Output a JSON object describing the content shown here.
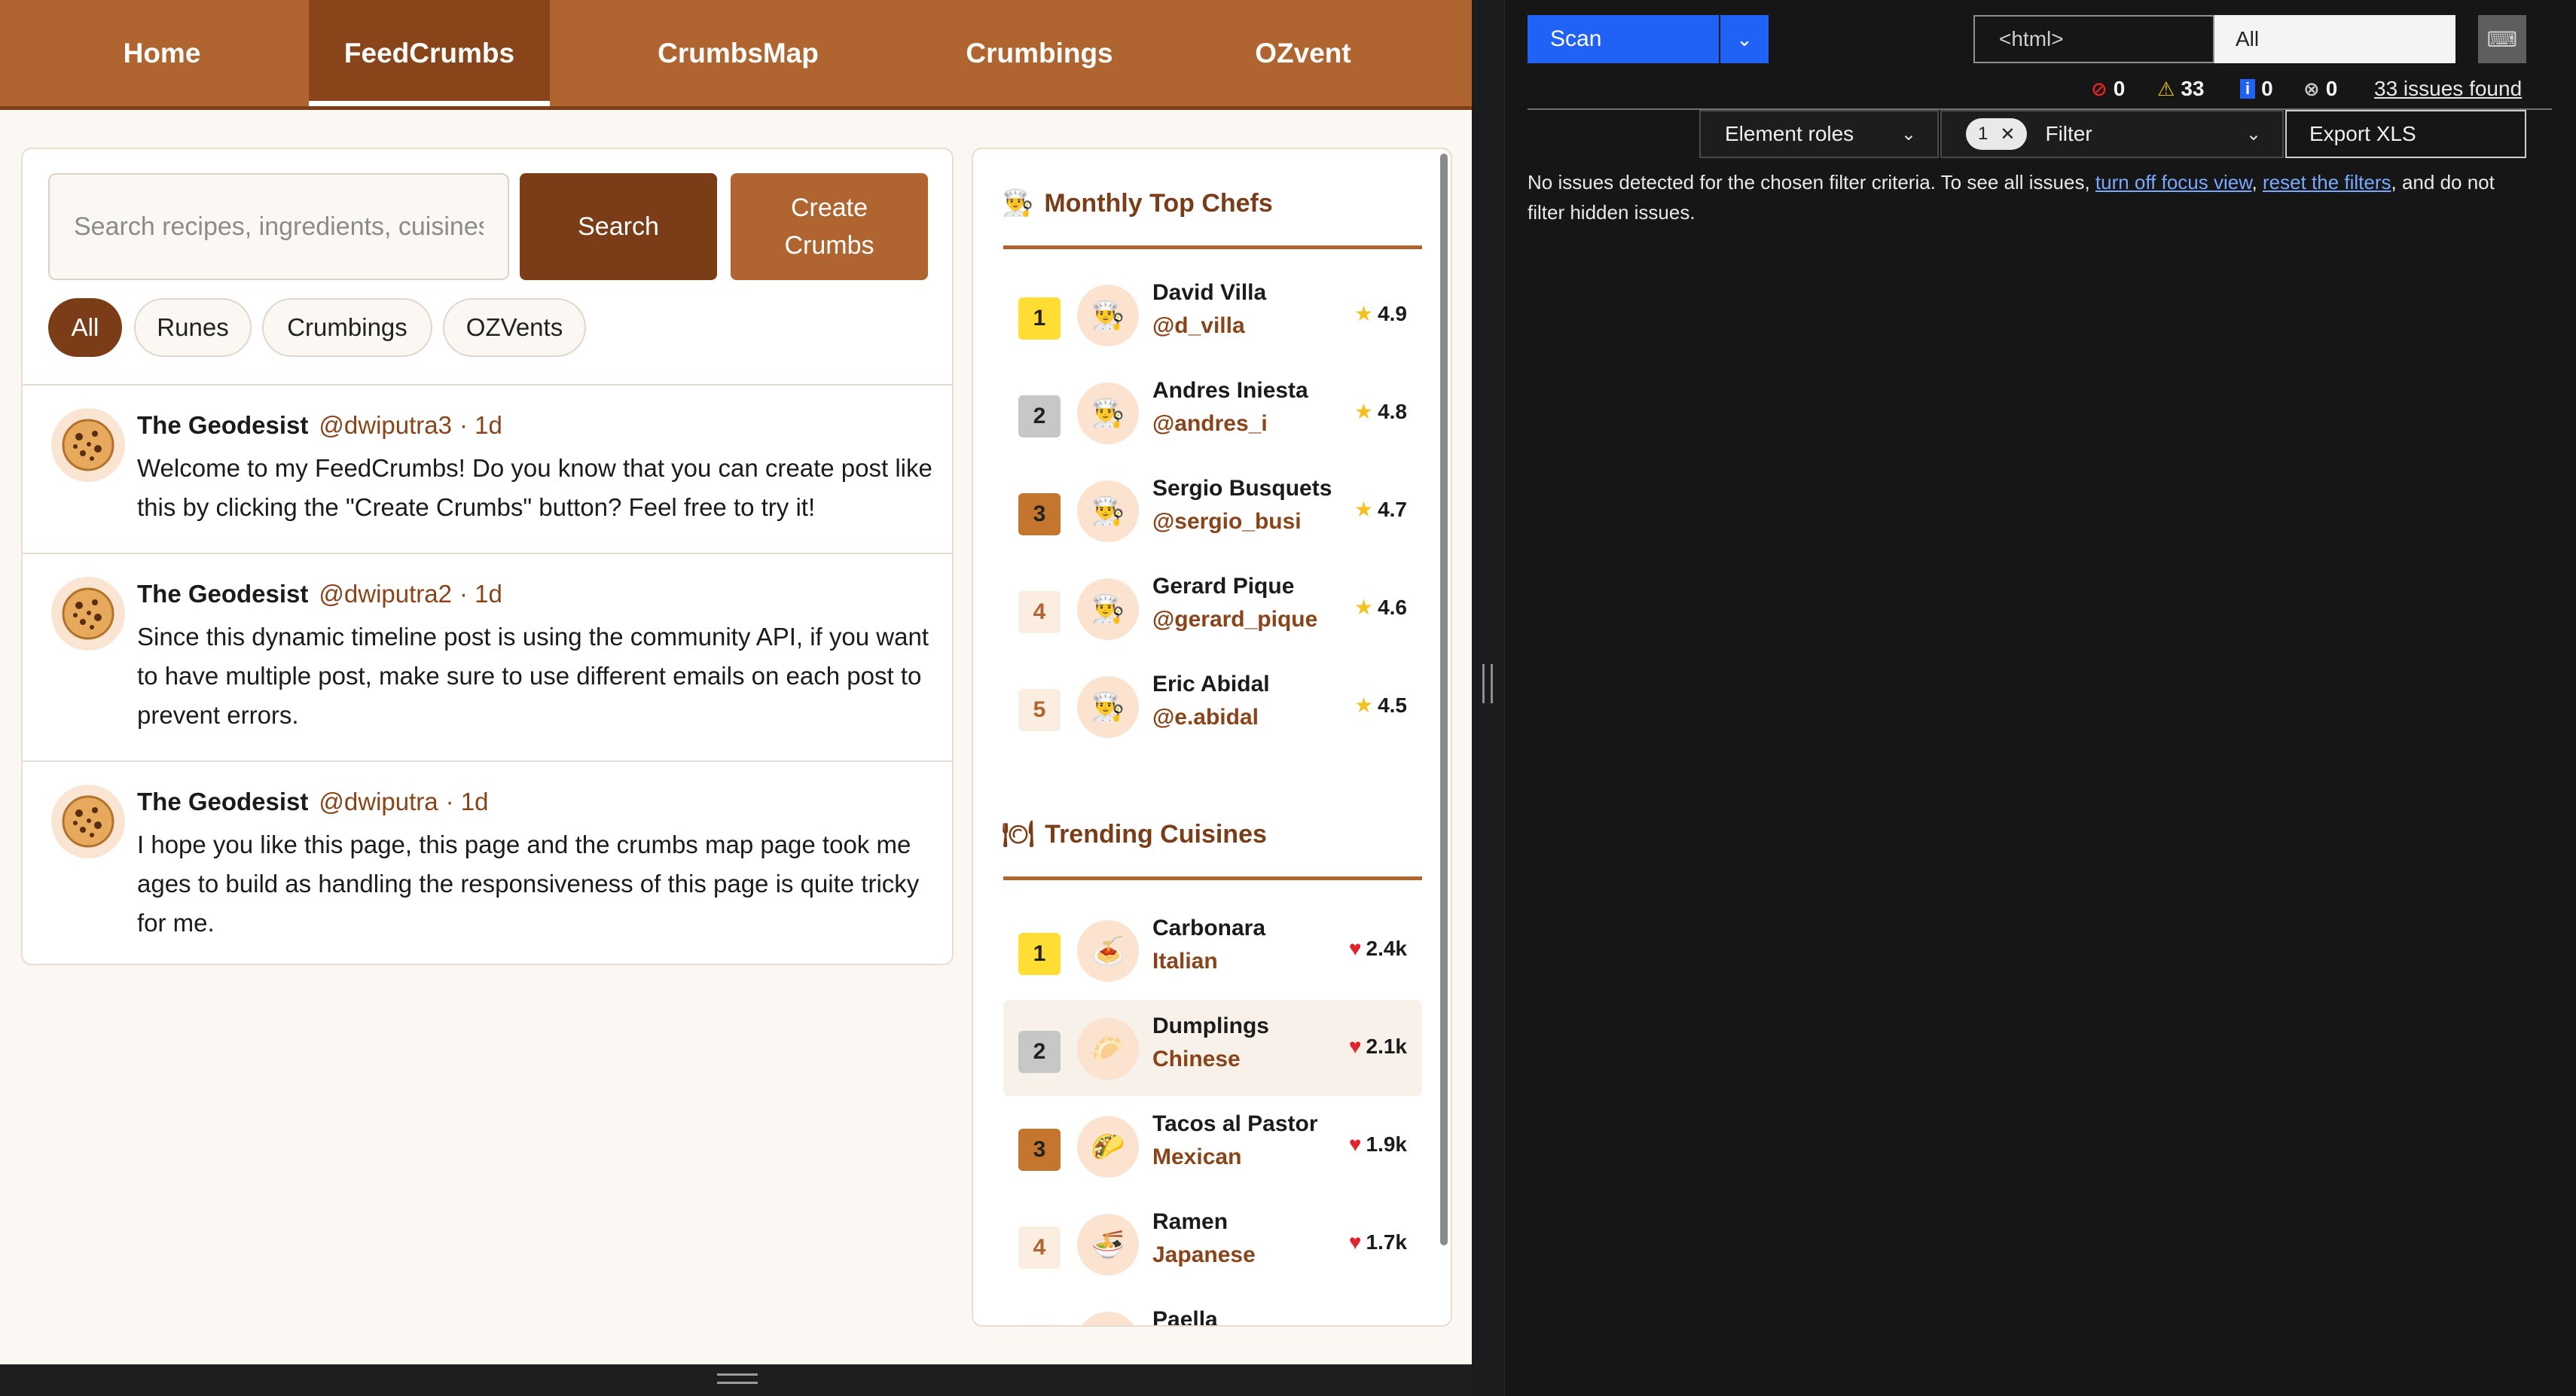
{
  "nav": {
    "items": [
      {
        "label": "Home"
      },
      {
        "label": "FeedCrumbs",
        "active": true
      },
      {
        "label": "CrumbsMap"
      },
      {
        "label": "Crumbings"
      },
      {
        "label": "OZvent"
      }
    ]
  },
  "feed": {
    "search_placeholder": "Search recipes, ingredients, cuisines...",
    "search_button": "Search",
    "create_button": "Create Crumbs",
    "filters": [
      "All",
      "Runes",
      "Crumbings",
      "OZVents"
    ],
    "active_filter": "All",
    "posts": [
      {
        "author": "The Geodesist",
        "handle": "@dwiputra3",
        "time": "· 1d",
        "avatar_icon": "cookie-icon",
        "text": "Welcome to my FeedCrumbs! Do you know that you can create post like this by clicking the \"Create Crumbs\" button? Feel free to try it!"
      },
      {
        "author": "The Geodesist",
        "handle": "@dwiputra2",
        "time": "· 1d",
        "avatar_icon": "cookie-icon",
        "text": "Since this dynamic timeline post is using the community API, if you want to have multiple post, make sure to use different emails on each post to prevent errors."
      },
      {
        "author": "The Geodesist",
        "handle": "@dwiputra",
        "time": "· 1d",
        "avatar_icon": "cookie-icon",
        "text": "I hope you like this page, this page and the crumbs map page took me ages to build as handling the responsiveness of this page is quite tricky for me."
      }
    ]
  },
  "side": {
    "chefs_title": "Monthly Top Chefs",
    "chefs_icon": "chef-icon",
    "chefs": [
      {
        "rank": "1",
        "name": "David Villa",
        "handle": "@d_villa",
        "rating": "4.9",
        "icon": "chef-icon"
      },
      {
        "rank": "2",
        "name": "Andres Iniesta",
        "handle": "@andres_i",
        "rating": "4.8",
        "icon": "chef-icon"
      },
      {
        "rank": "3",
        "name": "Sergio Busquets",
        "handle": "@sergio_busi",
        "rating": "4.7",
        "icon": "chef-icon"
      },
      {
        "rank": "4",
        "name": "Gerard Pique",
        "handle": "@gerard_pique",
        "rating": "4.6",
        "icon": "chef-icon"
      },
      {
        "rank": "5",
        "name": "Eric Abidal",
        "handle": "@e.abidal",
        "rating": "4.5",
        "icon": "chef-icon"
      }
    ],
    "cuisines_title": "Trending Cuisines",
    "cuisines_icon": "plate-icon",
    "cuisines": [
      {
        "rank": "1",
        "name": "Carbonara",
        "origin": "Italian",
        "likes": "2.4k",
        "icon": "spaghetti-icon"
      },
      {
        "rank": "2",
        "name": "Dumplings",
        "origin": "Chinese",
        "likes": "2.1k",
        "icon": "dumpling-icon"
      },
      {
        "rank": "3",
        "name": "Tacos al Pastor",
        "origin": "Mexican",
        "likes": "1.9k",
        "icon": "taco-icon"
      },
      {
        "rank": "4",
        "name": "Ramen",
        "origin": "Japanese",
        "likes": "1.7k",
        "icon": "ramen-icon"
      },
      {
        "rank": "",
        "name": "Paella",
        "origin": "",
        "likes": "",
        "icon": "paella-icon"
      }
    ]
  },
  "devtools": {
    "scan_label": "Scan",
    "target_field": "<html>",
    "scope_field": "All",
    "counts": {
      "errors": "0",
      "warnings": "33",
      "info": "0",
      "hidden": "0"
    },
    "issues_link": "33 issues found",
    "roles_dropdown": "Element roles",
    "filter_count": "1",
    "filter_label": "Filter",
    "export_label": "Export XLS",
    "message_prefix": "No issues detected for the chosen filter criteria. To see all issues,",
    "link_focus": "turn off focus view",
    "link_reset": "reset the filters",
    "message_suffix": "and do not filter hidden issues."
  },
  "colors": {
    "brand": "#b0642f",
    "brand_dark": "#7a3d17",
    "scan_blue": "#1f62f5"
  }
}
